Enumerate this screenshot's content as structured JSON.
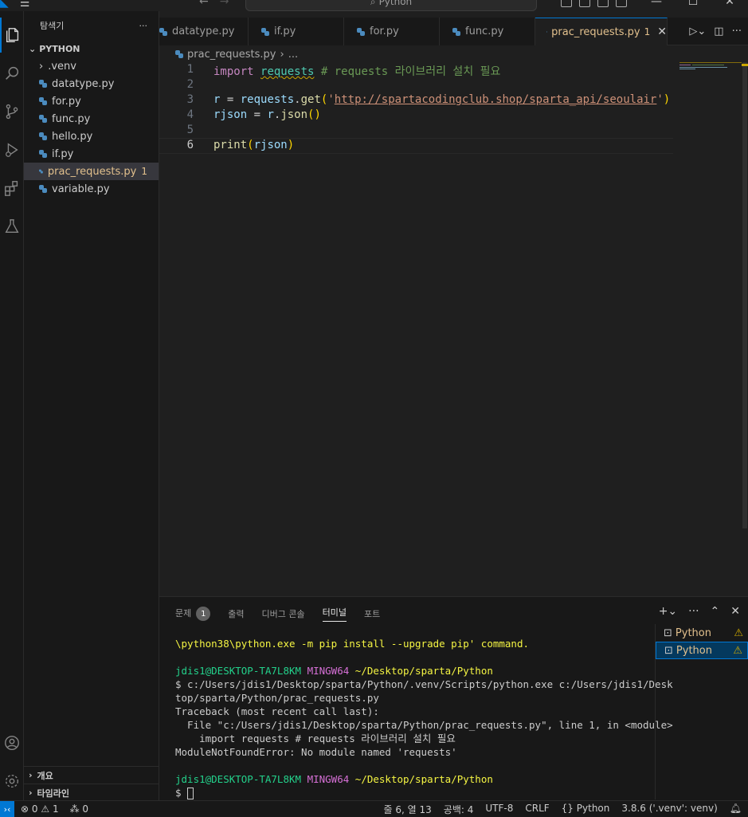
{
  "titlebar": {
    "search_text": "Python"
  },
  "sidebar": {
    "title": "탐색기",
    "more": "···",
    "folder": "PYTHON",
    "items": [
      {
        "label": ".venv",
        "type": "folder"
      },
      {
        "label": "datatype.py",
        "type": "file"
      },
      {
        "label": "for.py",
        "type": "file"
      },
      {
        "label": "func.py",
        "type": "file"
      },
      {
        "label": "hello.py",
        "type": "file"
      },
      {
        "label": "if.py",
        "type": "file"
      },
      {
        "label": "prac_requests.py",
        "type": "file",
        "badge": "1",
        "active": true
      },
      {
        "label": "variable.py",
        "type": "file"
      }
    ],
    "outline": "개요",
    "timeline": "타임라인"
  },
  "tabs": [
    {
      "label": "datatype.py"
    },
    {
      "label": "if.py"
    },
    {
      "label": "for.py"
    },
    {
      "label": "func.py"
    },
    {
      "label": "prac_requests.py",
      "badge": "1",
      "active": true
    }
  ],
  "breadcrumb": {
    "file": "prac_requests.py",
    "rest": "..."
  },
  "editor": {
    "line_numbers": [
      "1",
      "2",
      "3",
      "4",
      "5",
      "6"
    ],
    "line1": {
      "kw": "import",
      "mod": "requests",
      "comment": "# requests 라이브러리 설치 필요"
    },
    "line3": {
      "var": "r",
      "eq": " = ",
      "obj": "requests",
      "dot": ".",
      "fn": "get",
      "open": "(",
      "q1": "'",
      "url": "http://spartacodingclub.shop/sparta_api/seoulair",
      "q2": "'",
      "close": ")"
    },
    "line4": {
      "var": "rjson",
      "eq": " = ",
      "obj": "r",
      "dot": ".",
      "fn": "json",
      "parens": "()"
    },
    "line6": {
      "fn": "print",
      "open": "(",
      "arg": "rjson",
      "close": ")"
    }
  },
  "panel": {
    "tabs": [
      {
        "label": "문제",
        "badge": "1"
      },
      {
        "label": "출력"
      },
      {
        "label": "디버그 콘솔"
      },
      {
        "label": "터미널",
        "active": true
      },
      {
        "label": "포트"
      }
    ],
    "terminal_lines": [
      {
        "text": "\\python38\\python.exe -m pip install --upgrade pip' command.",
        "style": "t-yellow"
      },
      {
        "text": "",
        "style": ""
      },
      {
        "prompt": true,
        "user": "jdis1@DESKTOP-TA7L8KM",
        "sys": "MINGW64",
        "path": "~/Desktop/sparta/Python"
      },
      {
        "text": "$ c:/Users/jdis1/Desktop/sparta/Python/.venv/Scripts/python.exe c:/Users/jdis1/Desk",
        "style": ""
      },
      {
        "text": "top/sparta/Python/prac_requests.py",
        "style": ""
      },
      {
        "text": "Traceback (most recent call last):",
        "style": ""
      },
      {
        "text": "  File \"c:/Users/jdis1/Desktop/sparta/Python/prac_requests.py\", line 1, in <module>",
        "style": ""
      },
      {
        "text": "    import requests # requests 라이브러리 설치 필요",
        "style": ""
      },
      {
        "text": "ModuleNotFoundError: No module named 'requests'",
        "style": ""
      },
      {
        "text": "",
        "style": ""
      },
      {
        "prompt": true,
        "user": "jdis1@DESKTOP-TA7L8KM",
        "sys": "MINGW64",
        "path": "~/Desktop/sparta/Python"
      },
      {
        "text": "$ ",
        "style": "",
        "cursor": true
      }
    ],
    "terminals": [
      {
        "label": "Python"
      },
      {
        "label": "Python",
        "active": true
      }
    ]
  },
  "statusbar": {
    "errors": "0",
    "warnings": "1",
    "ports": "0",
    "position": "줄 6, 열 13",
    "spaces": "공백: 4",
    "encoding": "UTF-8",
    "eol": "CRLF",
    "language": "Python",
    "interpreter": "3.8.6 ('.venv': venv)"
  }
}
